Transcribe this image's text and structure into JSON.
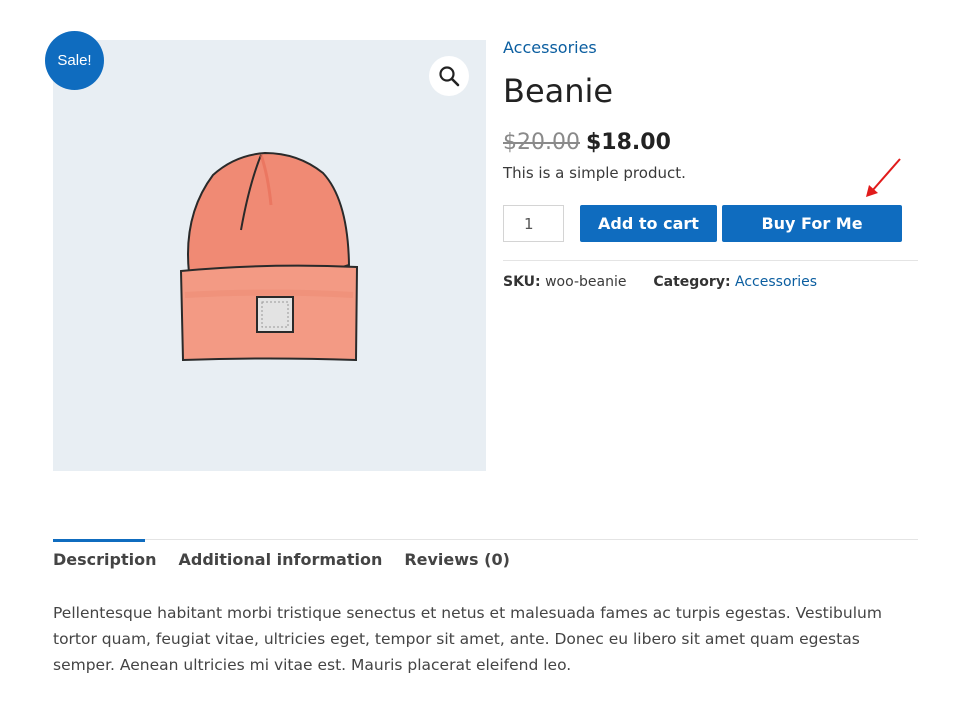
{
  "product": {
    "sale_badge": "Sale!",
    "category_link": "Accessories",
    "title": "Beanie",
    "old_price": "$20.00",
    "new_price": "$18.00",
    "short_description": "This is a simple product.",
    "quantity": "1",
    "add_to_cart_label": "Add to cart",
    "buy_for_me_label": "Buy For Me",
    "sku_label": "SKU:",
    "sku_value": "woo-beanie",
    "category_label": "Category:",
    "category_value": "Accessories",
    "colors": {
      "accent": "#0f6cbf",
      "image_bg": "#e8eef3",
      "beanie": "#f28b73",
      "annotation_arrow": "#e11b1b"
    }
  },
  "tabs": [
    {
      "label": "Description"
    },
    {
      "label": "Additional information"
    },
    {
      "label": "Reviews (0)"
    }
  ],
  "description_text": "Pellentesque habitant morbi tristique senectus et netus et malesuada fames ac turpis egestas. Vestibulum tortor quam, feugiat vitae, ultricies eget, tempor sit amet, ante. Donec eu libero sit amet quam egestas semper. Aenean ultricies mi vitae est. Mauris placerat eleifend leo.",
  "icons": {
    "zoom": "magnifier-icon",
    "annotation": "arrow-icon"
  }
}
